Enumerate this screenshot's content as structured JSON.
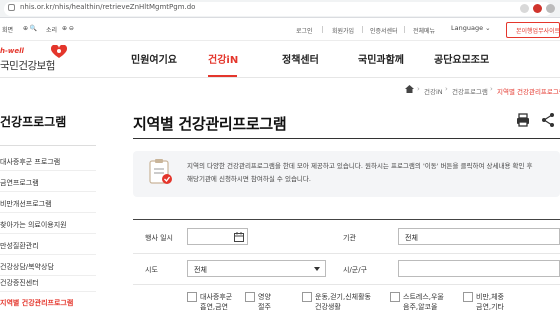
{
  "browser": {
    "url": "nhis.or.kr/nhis/healthin/retrieveZnHltMgmtPgm.do"
  },
  "util": {
    "left_a": "회면",
    "left_b": "소리",
    "links": [
      "로그인",
      "회원가입",
      "인증서센터",
      "전체메뉴"
    ],
    "language": "Language",
    "branch_button": "본이행업무사이트"
  },
  "logo": {
    "sub": "h-well",
    "main": "국민건강보험"
  },
  "gnb": {
    "items": [
      "민원여기요",
      "건강iN",
      "정책센터",
      "국민과함께",
      "공단요모조모"
    ]
  },
  "breadcrumb": {
    "items": [
      "건강iN",
      "건강프로그램",
      "지역별 건강관리프로그램"
    ]
  },
  "sidebar": {
    "title": "건강프로그램",
    "items": [
      "대사증후군 프로그램",
      "금연프로그램",
      "비만개선프로그램",
      "찾아가는 의료이용지원",
      "만성질환관리",
      "건강상담/복약상담",
      "건강증진센터",
      "지역별 건강관리프로그램"
    ]
  },
  "page": {
    "title": "지역별 건강관리프로그램",
    "info_line1": "지역의 다양한 건강관리프로그램을 한데 모아 제공하고 있습니다. 원하시는 프로그램의 '이동' 버튼을 클릭하여 상세내용 확인 후",
    "info_line2": "해당기관에 신청하시면 참여하실 수 있습니다."
  },
  "form": {
    "label_date": "행사 일시",
    "label_org": "기관",
    "org_value": "전체",
    "label_sido": "시도",
    "sido_value": "전체",
    "label_sigungu": "시/군/구",
    "sigungu_value": "",
    "checkbox_row1": [
      "대사증후군",
      "영양",
      "운동,걷기,신체활동",
      "스트레스,우울",
      "비만,체중"
    ],
    "checkbox_row2": [
      "흡연,금연",
      "절주",
      "건강생활",
      "음주,알코올",
      "금연,기타"
    ]
  }
}
